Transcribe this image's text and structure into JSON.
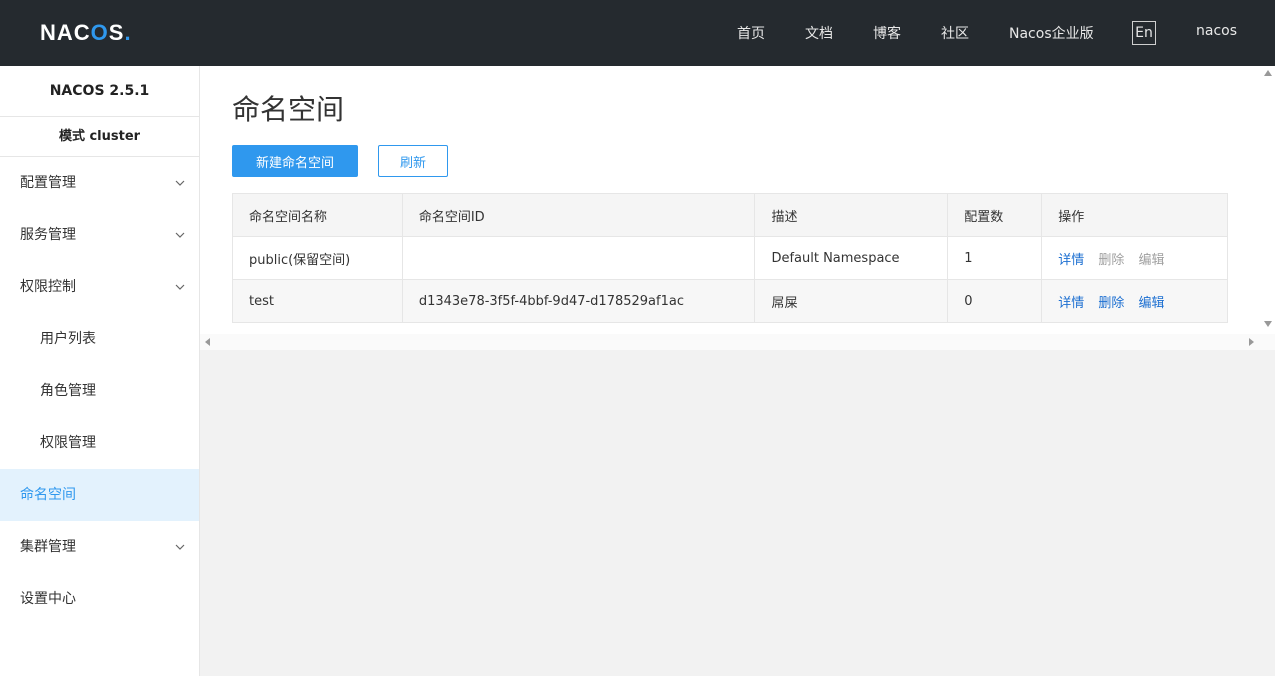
{
  "header": {
    "logo": {
      "part1": "NAC",
      "part2": "O",
      "part3": "S",
      "dot": "."
    },
    "nav": [
      {
        "label": "首页"
      },
      {
        "label": "文档"
      },
      {
        "label": "博客"
      },
      {
        "label": "社区"
      },
      {
        "label": "Nacos企业版"
      }
    ],
    "lang": "En",
    "user": "nacos"
  },
  "sidebar": {
    "version": "NACOS 2.5.1",
    "mode": "模式  cluster",
    "items": [
      {
        "label": "配置管理",
        "icon": "chevron-down-icon"
      },
      {
        "label": "服务管理",
        "icon": "chevron-down-icon"
      },
      {
        "label": "权限控制",
        "icon": "chevron-down-icon"
      },
      {
        "label": "用户列表"
      },
      {
        "label": "角色管理"
      },
      {
        "label": "权限管理"
      },
      {
        "label": "命名空间",
        "active": true
      },
      {
        "label": "集群管理",
        "icon": "chevron-down-icon"
      },
      {
        "label": "设置中心"
      }
    ]
  },
  "main": {
    "title": "命名空间",
    "create_button": "新建命名空间",
    "refresh_button": "刷新",
    "table": {
      "headers": [
        "命名空间名称",
        "命名空间ID",
        "描述",
        "配置数",
        "操作"
      ],
      "rows": [
        {
          "name": "public(保留空间)",
          "id": "",
          "desc": "Default Namespace",
          "count": "1",
          "actions": [
            "详情",
            "删除",
            "编辑"
          ]
        },
        {
          "name": "test",
          "id": "d1343e78-3f5f-4bbf-9d47-d178529af1ac",
          "desc": "屌屎",
          "count": "0",
          "actions": [
            "详情",
            "删除",
            "编辑"
          ]
        }
      ]
    }
  },
  "colors": {
    "header_bg": "#252a2f",
    "accent": "#2f98ee",
    "link": "#1c6fd1",
    "disabled_link": "#a0a0a0",
    "active_bg": "#e3f2fd"
  }
}
